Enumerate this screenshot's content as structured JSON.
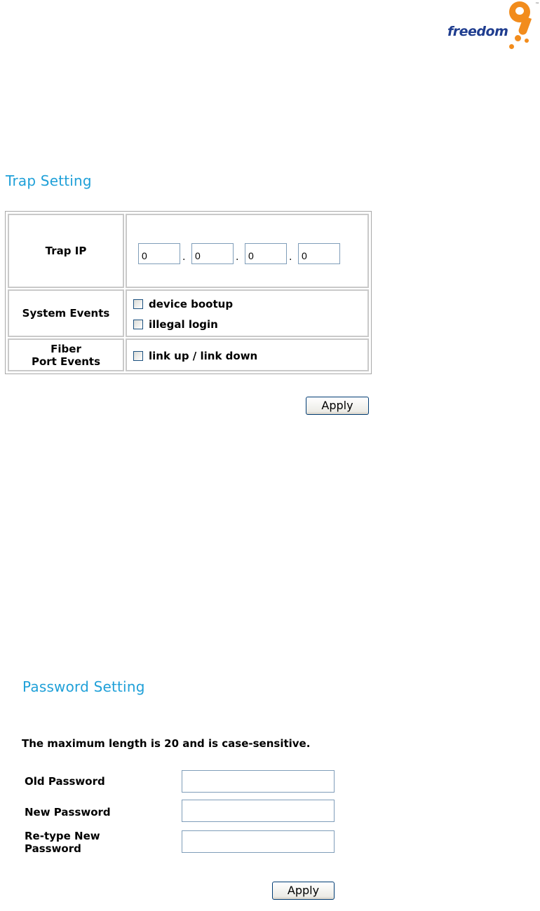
{
  "logo": {
    "text": "freedom",
    "tm": "™",
    "icon": "freedom9-logo"
  },
  "trap": {
    "title": "Trap Setting",
    "ip_label": "Trap IP",
    "ip_octets": [
      "0",
      "0",
      "0",
      "0"
    ],
    "ip_separator": ".",
    "system_events_label": "System Events",
    "system_events": [
      {
        "label": "device bootup",
        "checked": false
      },
      {
        "label": "illegal login",
        "checked": false
      }
    ],
    "fiber_label_line1": "Fiber",
    "fiber_label_line2": "Port Events",
    "fiber_events": [
      {
        "label": "link up / link down",
        "checked": false
      }
    ],
    "apply_label": "Apply"
  },
  "password": {
    "title": "Password Setting",
    "note": "The maximum length is 20 and is case-sensitive.",
    "old_label": "Old Password",
    "new_label": "New Password",
    "retype_label_line1": "Re-type New",
    "retype_label_line2": "Password",
    "old_value": "",
    "new_value": "",
    "retype_value": "",
    "apply_label": "Apply"
  },
  "colors": {
    "title": "#1fa0d8",
    "logo_blue": "#1f3d8f",
    "logo_orange": "#f28c1c"
  }
}
